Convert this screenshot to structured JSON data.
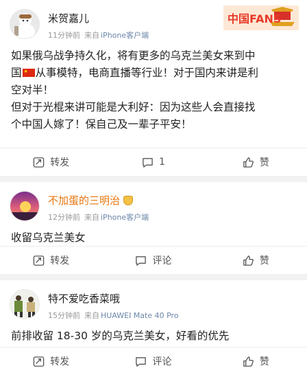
{
  "posts": [
    {
      "username": "米贺嘉儿",
      "time": "11分钟前",
      "source": "来自",
      "device": "iPhone客户端",
      "content_lines": [
        "如果俄乌战争持久化，将有更多的乌克兰美女来到中",
        "从事模特，电商直播等行业！对于国内来讲是利",
        "空对半！",
        "但对于光棍来讲可能是大利好：因为这些人会直接找",
        "个中国人嫁了！保自己及一辈子平安！"
      ],
      "content_prefix": "国",
      "repost_label": "转发",
      "comment_label": "1",
      "like_label": "赞"
    },
    {
      "username": "不加蛋的三明治",
      "time": "12分钟前",
      "source": "来自",
      "device": "iPhone客户端",
      "content": "收留乌克兰美女",
      "repost_label": "转发",
      "comment_label": "评论",
      "like_label": "赞"
    },
    {
      "username": "特不爱吃香菜哦",
      "time": "15分钟前",
      "source": "来自",
      "device": "HUAWEI Mate 40 Pro",
      "content": "前排收留 18-30 岁的乌克兰美女，好看的优先",
      "repost_label": "转发",
      "comment_label": "评论",
      "like_label": "赞"
    }
  ],
  "fans_logo": "中国FANS",
  "icons": {
    "repost": "repost-icon",
    "comment": "comment-icon",
    "like": "thumbs-up-icon",
    "badge": "crown-badge-icon"
  },
  "colors": {
    "accent_orange": "#e8750d",
    "device_blue": "#6b86a8",
    "flag_red": "#de2910"
  }
}
